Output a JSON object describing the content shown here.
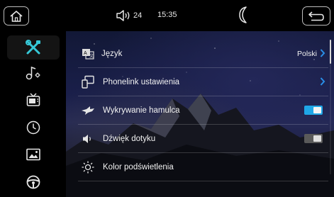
{
  "status_bar": {
    "volume_level": "24",
    "time": "15:35"
  },
  "sidebar": {
    "items": [
      {
        "icon": "tools-icon",
        "active": true
      },
      {
        "icon": "music-settings-icon",
        "active": false
      },
      {
        "icon": "tv-icon",
        "active": false
      },
      {
        "icon": "clock-icon",
        "active": false
      },
      {
        "icon": "picture-icon",
        "active": false
      },
      {
        "icon": "steering-wheel-icon",
        "active": false
      }
    ]
  },
  "settings": {
    "language": {
      "label": "Język",
      "value": "Polski"
    },
    "phonelink": {
      "label": "Phonelink ustawienia"
    },
    "brake_detection": {
      "label": "Wykrywanie hamulca",
      "enabled": true
    },
    "touch_sound": {
      "label": "Dźwięk dotyku",
      "enabled": false
    },
    "backlight_color": {
      "label": "Kolor podświetlenia"
    }
  },
  "colors": {
    "toggle_on": "#1fa7e8",
    "accent_chevron": "#2a8fe8",
    "active_icon": "#36c9d8"
  }
}
